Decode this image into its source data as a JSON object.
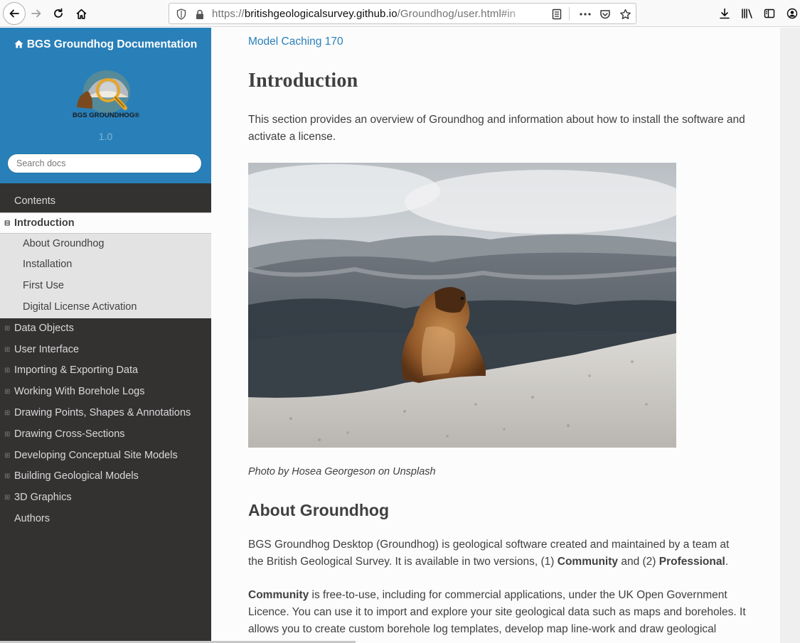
{
  "browser": {
    "url_host": "britishgeologicalsurvey.github.io",
    "url_scheme": "https://",
    "url_path": "/Groundhog/user.html#in"
  },
  "sidebar": {
    "title": "BGS Groundhog Documentation",
    "logo_text": "BGS GROUNDHOG",
    "version": "1.0",
    "search_placeholder": "Search docs",
    "items": [
      {
        "label": "Contents",
        "toggle": ""
      },
      {
        "label": "Introduction",
        "toggle": "⊟"
      },
      {
        "label": "About Groundhog"
      },
      {
        "label": "Installation"
      },
      {
        "label": "First Use"
      },
      {
        "label": "Digital License Activation"
      },
      {
        "label": "Data Objects",
        "toggle": "⊞"
      },
      {
        "label": "User Interface",
        "toggle": "⊞"
      },
      {
        "label": "Importing & Exporting Data",
        "toggle": "⊞"
      },
      {
        "label": "Working With Borehole Logs",
        "toggle": "⊞"
      },
      {
        "label": "Drawing Points, Shapes & Annotations",
        "toggle": "⊞"
      },
      {
        "label": "Drawing Cross-Sections",
        "toggle": "⊞"
      },
      {
        "label": "Developing Conceptual Site Models",
        "toggle": "⊞"
      },
      {
        "label": "Building Geological Models",
        "toggle": "⊞"
      },
      {
        "label": "3D Graphics",
        "toggle": "⊞"
      },
      {
        "label": "Authors",
        "toggle": ""
      }
    ]
  },
  "content": {
    "prev_link": "Model Caching 170",
    "h1": "Introduction",
    "intro": "This section provides an overview of Groundhog and information about how to install the software and activate a license.",
    "caption": "Photo by Hosea Georgeson on Unsplash",
    "h2": "About Groundhog",
    "p1_a": "BGS Groundhog Desktop (Groundhog) is geological software created and maintained by a team at the British Geological Survey. It is available in two versions, (1) ",
    "p1_b": "Community",
    "p1_c": " and (2) ",
    "p1_d": "Professional",
    "p1_e": ".",
    "p2_a": "Community",
    "p2_b": " is free-to-use, including for commercial applications, under the UK Open Government Licence. You can use it to import and explore your site geological data such as maps and boreholes. It allows you to create custom borehole log templates, develop map line-work and draw geological"
  },
  "colors": {
    "sidebar_bg": "#343131",
    "sidebar_header": "#2980b9",
    "link": "#2980b9",
    "text": "#404040"
  }
}
